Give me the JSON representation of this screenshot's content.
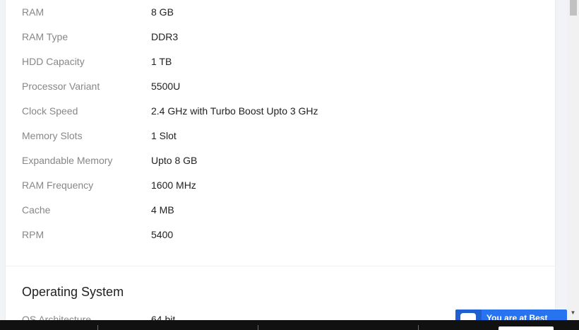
{
  "specs": [
    {
      "key": "RAM",
      "value": "8 GB"
    },
    {
      "key": "RAM Type",
      "value": "DDR3"
    },
    {
      "key": "HDD Capacity",
      "value": "1 TB"
    },
    {
      "key": "Processor Variant",
      "value": "5500U"
    },
    {
      "key": "Clock Speed",
      "value": "2.4 GHz with Turbo Boost Upto 3 GHz"
    },
    {
      "key": "Memory Slots",
      "value": "1 Slot"
    },
    {
      "key": "Expandable Memory",
      "value": "Upto 8 GB"
    },
    {
      "key": "RAM Frequency",
      "value": "1600 MHz"
    },
    {
      "key": "Cache",
      "value": "4 MB"
    },
    {
      "key": "RPM",
      "value": "5400"
    }
  ],
  "os_section": {
    "title": "Operating System",
    "first_row": {
      "key": "OS Architecture",
      "value": "64 bit"
    }
  },
  "location_widget": {
    "text": "You are at Best",
    "icon": "chat-bubble-icon"
  },
  "colors": {
    "label": "#878787",
    "value": "#212121",
    "accent": "#2874f0",
    "bottom_bar": "#111111"
  }
}
